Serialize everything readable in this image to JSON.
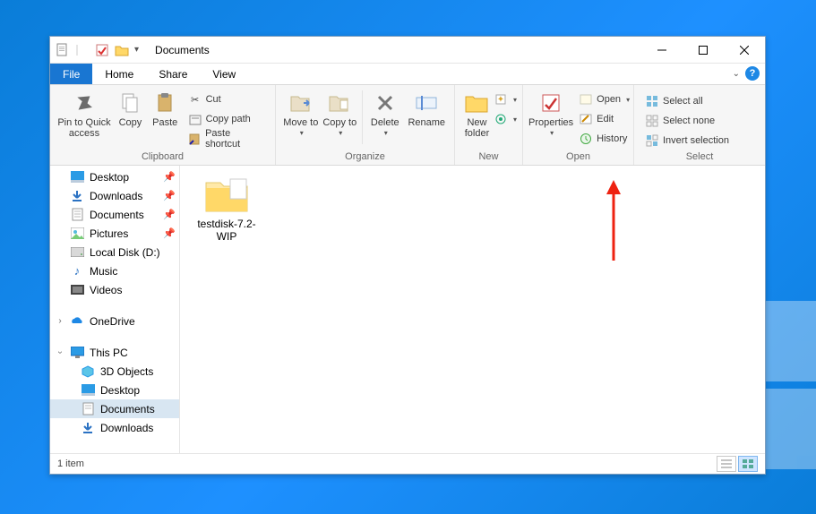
{
  "title": "Documents",
  "tabs": {
    "file": "File",
    "home": "Home",
    "share": "Share",
    "view": "View"
  },
  "ribbon": {
    "clipboard": {
      "label": "Clipboard",
      "pin": "Pin to Quick access",
      "copy": "Copy",
      "paste": "Paste",
      "cut": "Cut",
      "copypath": "Copy path",
      "pasteshortcut": "Paste shortcut"
    },
    "organize": {
      "label": "Organize",
      "moveto": "Move to",
      "copyto": "Copy to",
      "delete": "Delete",
      "rename": "Rename"
    },
    "new": {
      "label": "New",
      "newfolder": "New folder"
    },
    "open": {
      "label": "Open",
      "properties": "Properties",
      "open": "Open",
      "edit": "Edit",
      "history": "History"
    },
    "select": {
      "label": "Select",
      "selectall": "Select all",
      "selectnone": "Select none",
      "invert": "Invert selection"
    }
  },
  "nav": {
    "desktop": "Desktop",
    "downloads": "Downloads",
    "documents": "Documents",
    "pictures": "Pictures",
    "localdisk": "Local Disk (D:)",
    "music": "Music",
    "videos": "Videos",
    "onedrive": "OneDrive",
    "thispc": "This PC",
    "objects3d": "3D Objects",
    "desktop2": "Desktop",
    "documents2": "Documents",
    "downloads2": "Downloads"
  },
  "files": {
    "item1": "testdisk-7.2-WIP"
  },
  "status": {
    "count": "1 item"
  }
}
